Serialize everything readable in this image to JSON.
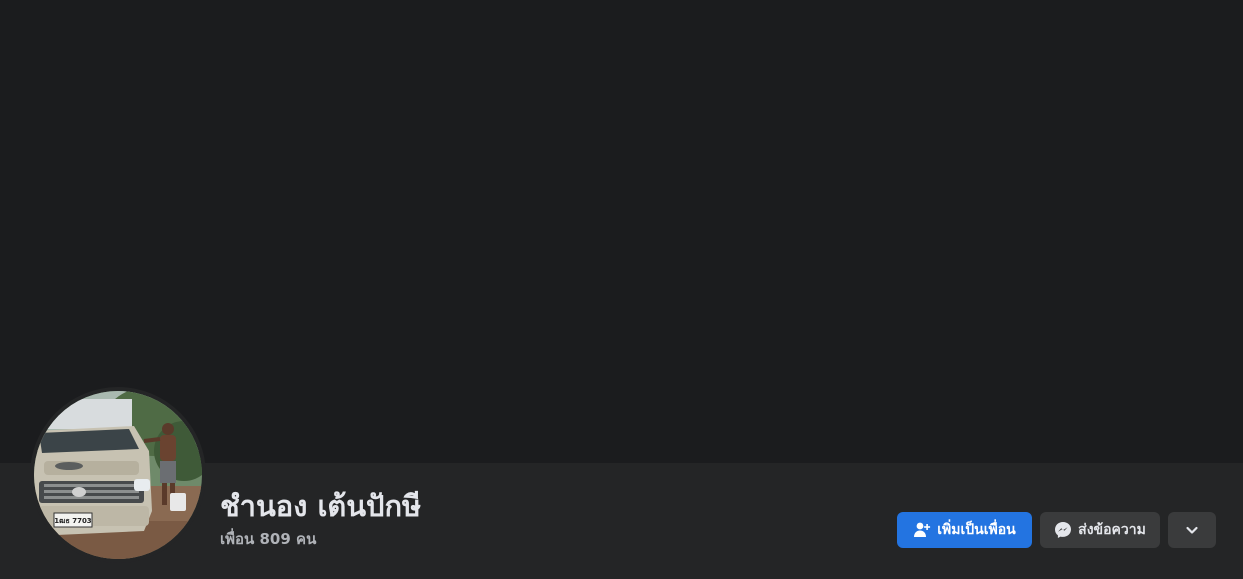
{
  "profile": {
    "name": "ชำนอง เต้นปักษี",
    "friends_text": "เพื่อน 809 คน",
    "avatar_plate_text": "1ฒธ 7703"
  },
  "actions": {
    "add_friend_label": "เพิ่มเป็นเพื่อน",
    "add_friend_icon": "person-add-icon",
    "message_label": "ส่งข้อความ",
    "message_icon": "messenger-icon",
    "more_icon": "chevron-down-icon"
  },
  "colors": {
    "cover_bg": "#1b1c1e",
    "page_bg": "#242526",
    "primary_button": "#2374e1",
    "secondary_button": "#3a3b3c",
    "text_primary": "#e4e6eb",
    "text_secondary": "#b0b3b8"
  }
}
